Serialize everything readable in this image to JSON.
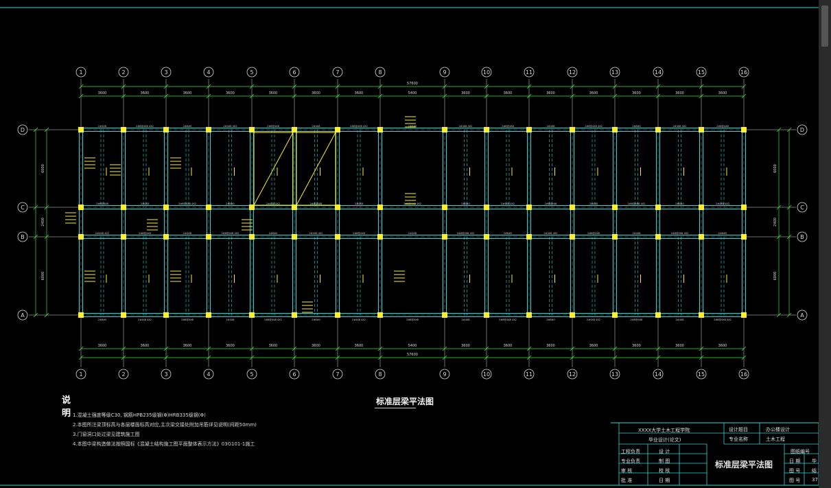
{
  "drawing": {
    "title": "标准层梁平法图",
    "axes_x": [
      "1",
      "2",
      "3",
      "4",
      "5",
      "6",
      "7",
      "8",
      "9",
      "10",
      "11",
      "12",
      "13",
      "14",
      "15",
      "16"
    ],
    "axes_y": [
      "D",
      "C",
      "B",
      "A"
    ],
    "overall_dim": "57600",
    "bay_dims": [
      "3600",
      "3600",
      "3600",
      "3600",
      "3600",
      "3600",
      "3600",
      "5400",
      "3600",
      "3600",
      "3600",
      "3600",
      "3600",
      "3600",
      "3600"
    ],
    "side_dims": [
      "6000",
      "2400",
      "6000"
    ],
    "beam_labels": [
      "2#4X8",
      "2#8@4X8",
      "2#4X8 4X2",
      "2#8#0",
      "2#8@4X8 4X2"
    ]
  },
  "notes": {
    "heading": "说明",
    "items": [
      "1.混凝土强度等级C30, 钢筋HPB235级钢(Φ)HRB335级钢(Φ)",
      "2.本图所注梁顶标高与各层楼面标高对应,主次梁交接处附加吊筋详见说明(间距50mm)",
      "3.门窗洞口处过梁见建筑施工图",
      "4.本图中梁构造做法按照国标《混凝土结构施工图平面整体表示方法》03G101-1施工"
    ]
  },
  "title_block": {
    "school": "XXXX大学土木工程学院",
    "thesis": "毕业设计(论文)",
    "project_label": "设计题目",
    "project_value": "办公楼设计",
    "major_label": "专业名称",
    "major_value": "土木工程",
    "rows": [
      [
        "工程负责",
        "设  计"
      ],
      [
        "专业负责",
        "制  图"
      ],
      [
        "审  核",
        "校  核"
      ],
      [
        "批  准",
        "日  期"
      ]
    ],
    "drawing_name": "标准层梁平法图",
    "right_header": "图纸编号",
    "right_rows": [
      [
        "日  期",
        "毕  业"
      ],
      [
        "图  号",
        "结  2"
      ],
      [
        "图  号",
        "37"
      ]
    ]
  }
}
